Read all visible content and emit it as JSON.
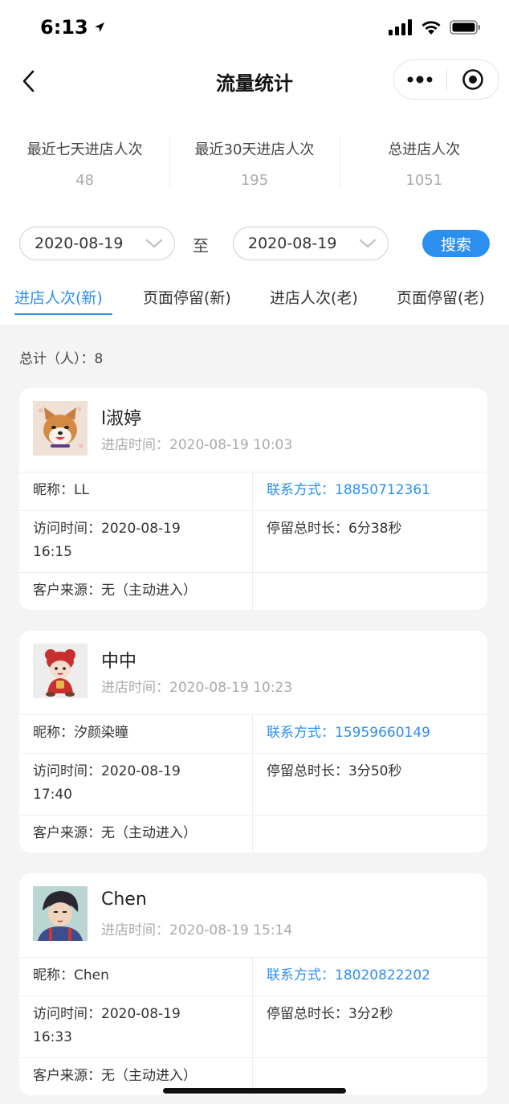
{
  "status_bar": {
    "time": "6:13"
  },
  "nav": {
    "title": "流量统计"
  },
  "stats": [
    {
      "label": "最近七天进店人次",
      "value": "48"
    },
    {
      "label": "最近30天进店人次",
      "value": "195"
    },
    {
      "label": "总进店人次",
      "value": "1051"
    }
  ],
  "filter": {
    "start_date": "2020-08-19",
    "to_label": "至",
    "end_date": "2020-08-19",
    "search_label": "搜索"
  },
  "tabs": [
    {
      "label": "进店人次(新)",
      "active": true
    },
    {
      "label": "页面停留(新)",
      "active": false
    },
    {
      "label": "进店人次(老)",
      "active": false
    },
    {
      "label": "页面停留(老)",
      "active": false
    }
  ],
  "total_label": "总计（人）：8",
  "cards": [
    {
      "name": "l淑婷",
      "enter_time": "进店时间：2020-08-19 10:03",
      "nickname": "昵称：LL",
      "contact": "联系方式：18850712361",
      "visit_time_line1": "访问时间：2020-08-19",
      "visit_time_line2": "16:15",
      "stay_duration": "停留总时长：6分38秒",
      "source": "客户来源：无（主动进入）"
    },
    {
      "name": "中中",
      "enter_time": "进店时间：2020-08-19 10:23",
      "nickname": "昵称：汐颜染瞳",
      "contact": "联系方式：15959660149",
      "visit_time_line1": "访问时间：2020-08-19",
      "visit_time_line2": "17:40",
      "stay_duration": "停留总时长：3分50秒",
      "source": "客户来源：无（主动进入）"
    },
    {
      "name": "Chen",
      "enter_time": "进店时间：2020-08-19 15:14",
      "nickname": "昵称：Chen",
      "contact": "联系方式：18020822202",
      "visit_time_line1": "访问时间：2020-08-19",
      "visit_time_line2": "16:33",
      "stay_duration": "停留总时长：3分2秒",
      "source": "客户来源：无（主动进入）"
    }
  ],
  "colors": {
    "accent": "#2b8ff0",
    "muted": "#aaaaaa",
    "background": "#f4f4f4"
  }
}
